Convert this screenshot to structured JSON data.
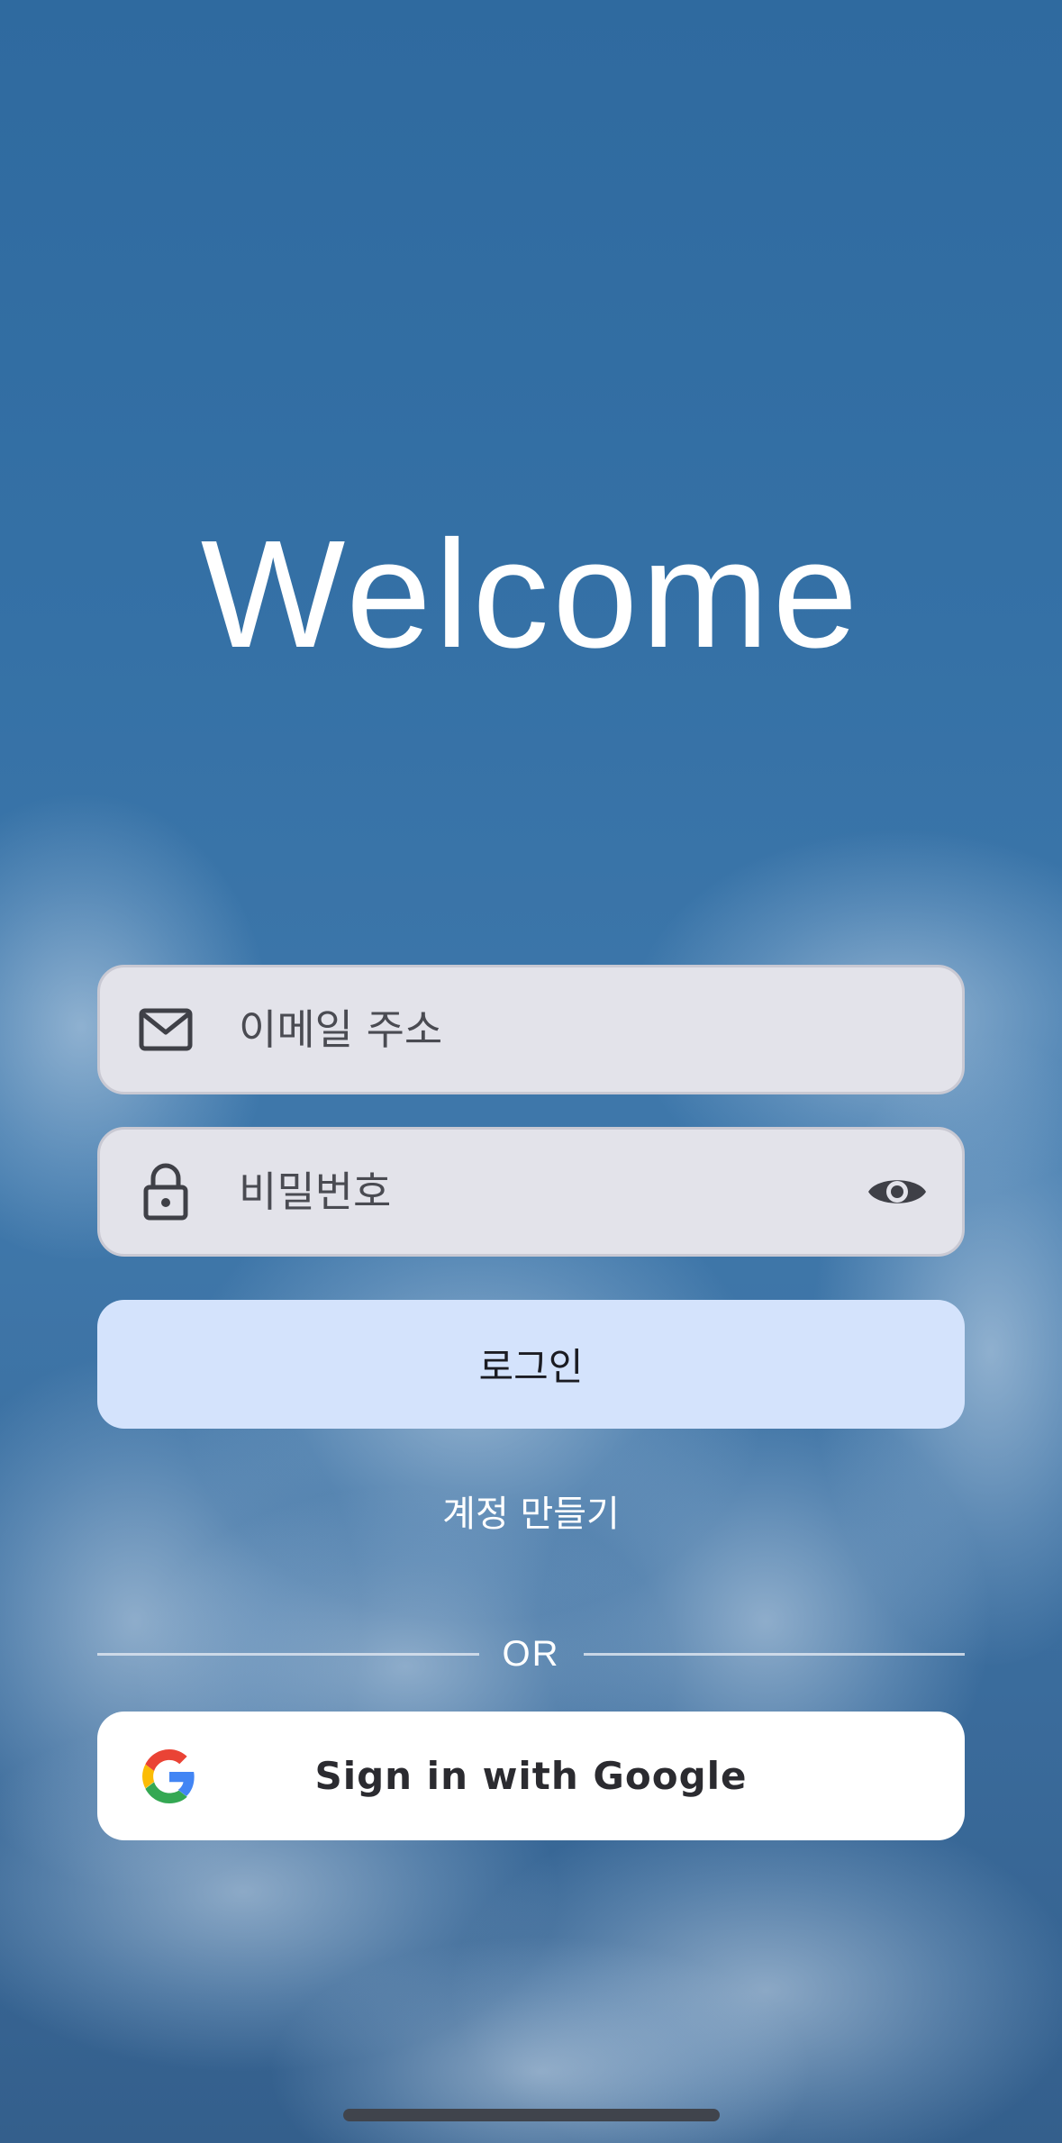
{
  "header": {
    "title": "Welcome"
  },
  "form": {
    "email": {
      "placeholder": "이메일 주소",
      "value": "",
      "icon": "mail-icon"
    },
    "password": {
      "placeholder": "비밀번호",
      "value": "",
      "icon": "lock-icon",
      "trailing_icon": "eye-icon"
    },
    "login_label": "로그인",
    "create_account_label": "계정 만들기"
  },
  "divider": {
    "label": "OR"
  },
  "google": {
    "label": "Sign in with Google",
    "icon": "google-logo-icon"
  },
  "colors": {
    "login_button_bg": "#d4e3fc",
    "field_bg": "#e3e3ea",
    "title_text": "#ffffff"
  }
}
